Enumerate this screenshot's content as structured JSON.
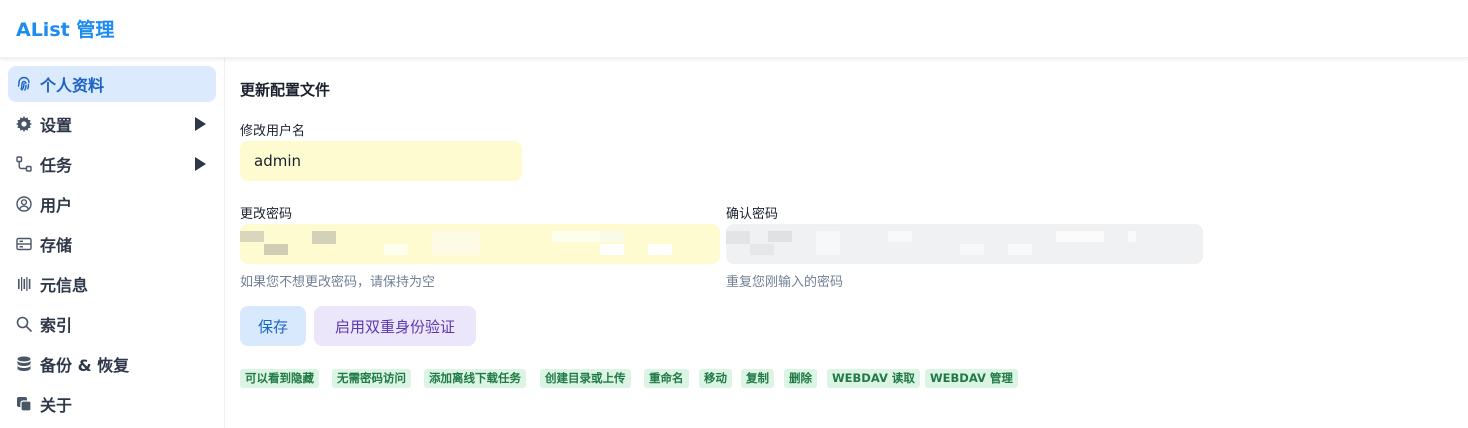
{
  "header": {
    "title": "AList 管理"
  },
  "sidebar": {
    "items": [
      {
        "label": "个人资料",
        "icon": "fingerprint-icon",
        "active": true,
        "expandable": false
      },
      {
        "label": "设置",
        "icon": "gear-icon",
        "active": false,
        "expandable": true
      },
      {
        "label": "任务",
        "icon": "tasks-flow-icon",
        "active": false,
        "expandable": true
      },
      {
        "label": "用户",
        "icon": "user-circle-icon",
        "active": false,
        "expandable": false
      },
      {
        "label": "存储",
        "icon": "storage-icon",
        "active": false,
        "expandable": false
      },
      {
        "label": "元信息",
        "icon": "metadata-icon",
        "active": false,
        "expandable": false
      },
      {
        "label": "索引",
        "icon": "search-icon",
        "active": false,
        "expandable": false
      },
      {
        "label": "备份 & 恢复",
        "icon": "database-icon",
        "active": false,
        "expandable": false
      },
      {
        "label": "关于",
        "icon": "copy-icon",
        "active": false,
        "expandable": false
      }
    ]
  },
  "main": {
    "title": "更新配置文件",
    "username": {
      "label": "修改用户名",
      "value": "admin"
    },
    "password": {
      "label": "更改密码",
      "helper": "如果您不想更改密码，请保持为空"
    },
    "confirm_password": {
      "label": "确认密码",
      "helper": "重复您刚输入的密码"
    },
    "buttons": {
      "save": "保存",
      "enable_2fa": "启用双重身份验证"
    },
    "permissions": [
      "可以看到隐藏",
      "无需密码访问",
      "添加离线下载任务",
      "创建目录或上传",
      "重命名",
      "移动",
      "复制",
      "删除",
      "WEBDAV 读取",
      "WEBDAV 管理"
    ]
  },
  "colors": {
    "brand": "#1c8cf0",
    "active_nav_bg": "#dceafd",
    "input_yellow": "#fefbd0",
    "input_gray": "#eff1f3",
    "tag_bg": "#dcf4e4",
    "tag_text": "#1f7a45"
  }
}
